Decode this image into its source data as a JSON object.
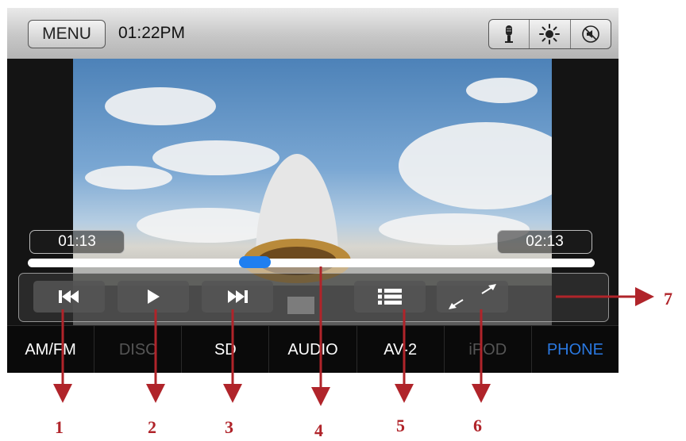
{
  "top_bar": {
    "menu_label": "MENU",
    "clock": "01:22PM",
    "icons": [
      "microphone-icon",
      "brightness-icon",
      "mute-icon"
    ]
  },
  "player": {
    "elapsed": "01:13",
    "total": "02:13",
    "progress_fraction": 0.4
  },
  "controls": {
    "buttons": [
      "previous-track-icon",
      "play-icon",
      "next-track-icon",
      "playlist-icon",
      "fullscreen-icon"
    ]
  },
  "source_bar": {
    "items": [
      {
        "label": "AM/FM",
        "state": "normal"
      },
      {
        "label": "DISC",
        "state": "disabled"
      },
      {
        "label": "SD",
        "state": "normal"
      },
      {
        "label": "AUDIO",
        "state": "normal"
      },
      {
        "label": "AV-2",
        "state": "normal"
      },
      {
        "label": "iPOD",
        "state": "disabled"
      },
      {
        "label": "PHONE",
        "state": "active"
      }
    ]
  },
  "callouts": [
    "1",
    "2",
    "3",
    "4",
    "5",
    "6",
    "7"
  ],
  "colors": {
    "accent": "#1f7ff0",
    "active_source": "#2a78e0",
    "callout": "#b0242a"
  }
}
